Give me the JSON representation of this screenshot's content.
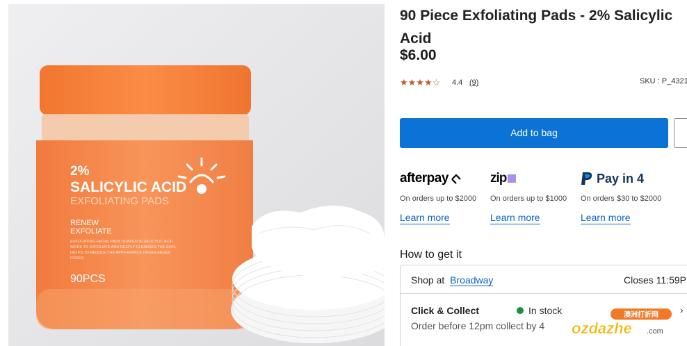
{
  "product": {
    "title": "90 Piece Exfoliating Pads - 2% Salicylic Acid",
    "price": "$6.00",
    "rating": "4.4",
    "review_count": "(9)",
    "sku": "SKU : P_4321",
    "image": {
      "jar_percent": "2%",
      "jar_name": "SALICYLIC ACID",
      "jar_subtitle": "EXFOLIATING PADS",
      "jar_tag1": "RENEW",
      "jar_tag2": "EXFOLIATE",
      "jar_desc1": "EXFOLIATING FACIAL PADS SOAKED IN SALICYLIC ACID",
      "jar_desc2": "WORK TO EXFOLIATE AND DEEPLY CLEANSES THE SKIN,",
      "jar_desc3": "HELPS TO REDUCE THE APPEARANCE ON ENLARGED",
      "jar_desc4": "PORES.",
      "jar_count": "90PCS"
    }
  },
  "actions": {
    "add_to_bag": "Add to bag"
  },
  "payments": [
    {
      "name": "afterpay",
      "note": "On orders up to $2000",
      "link": "Learn more"
    },
    {
      "name": "zip",
      "note": "On orders up to $1000",
      "link": "Learn more"
    },
    {
      "name": "Pay in 4",
      "note": "On orders $30 to $2000",
      "link": "Learn more"
    }
  ],
  "fulfilment": {
    "heading": "How to get it",
    "shop_label": "Shop at",
    "store": "Broadway",
    "closes": "Closes 11:59P",
    "cc_title": "Click & Collect",
    "stock": "In stock",
    "cc_note": "Order before 12pm collect by 4"
  },
  "watermark": {
    "cn": "澳洲打折网",
    "latin": "ozdazhe",
    "suffix": ".com"
  },
  "colors": {
    "accent": "#0c73d6",
    "link": "#0c64c7",
    "star": "#c05a2a",
    "in_stock": "#1b8f3a",
    "jar": "#f58a4f"
  }
}
